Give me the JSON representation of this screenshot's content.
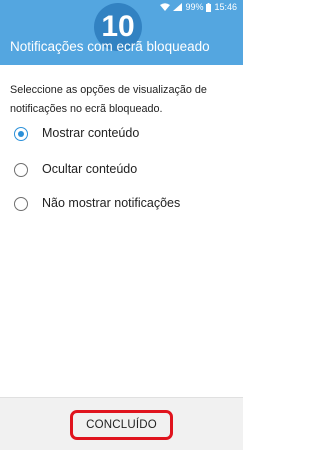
{
  "status_bar": {
    "battery": "99%",
    "time": "15:46"
  },
  "step_badge": "10",
  "header": {
    "title": "Notificações com ecrã bloqueado"
  },
  "description": "Seleccione as opções de visualização de notificações no ecrã bloqueado.",
  "options": [
    {
      "label": "Mostrar conteúdo",
      "checked": true
    },
    {
      "label": "Ocultar conteúdo",
      "checked": false
    },
    {
      "label": "Não mostrar notificações",
      "checked": false
    }
  ],
  "footer": {
    "done_label": "CONCLUÍDO"
  },
  "colors": {
    "header": "#54a6e0",
    "radio_accent": "#2b90d9",
    "highlight": "#e0141e"
  }
}
